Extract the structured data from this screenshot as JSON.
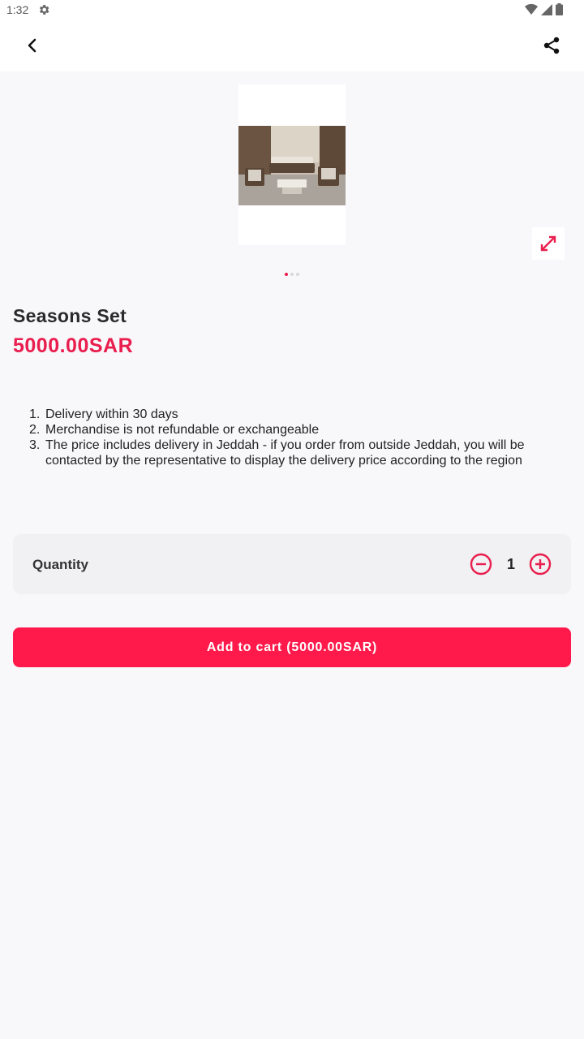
{
  "status_bar": {
    "time": "1:32",
    "icons": [
      "gear-icon",
      "wifi-icon",
      "signal-icon",
      "battery-icon"
    ]
  },
  "app_bar": {
    "back_icon": "chevron-left-icon",
    "share_icon": "share-icon"
  },
  "gallery": {
    "image_count": 3,
    "active_index": 0,
    "expand_icon": "expand-arrows-icon"
  },
  "product": {
    "title": "Seasons Set",
    "price": "5000.00SAR"
  },
  "description": [
    {
      "num": "1.",
      "text": "Delivery within 30 days"
    },
    {
      "num": "2.",
      "text": "Merchandise is not refundable or exchangeable"
    },
    {
      "num": "3.",
      "text": "The price includes delivery in Jeddah - if you order from outside Jeddah, you will be contacted by the representative to display the delivery price according to the region"
    }
  ],
  "quantity": {
    "label": "Quantity",
    "value": "1"
  },
  "cart_button": {
    "label": "Add to cart (5000.00SAR)"
  },
  "colors": {
    "accent": "#e91e4e",
    "button": "#ff1a4b",
    "background": "#f8f7fa"
  }
}
